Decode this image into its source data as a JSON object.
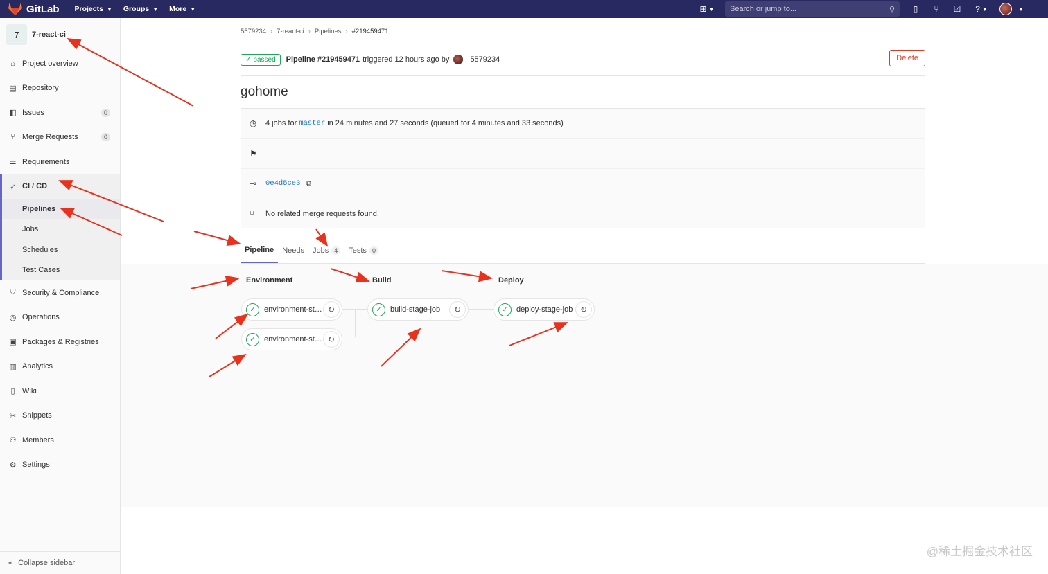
{
  "topbar": {
    "brand": "GitLab",
    "nav": [
      "Projects",
      "Groups",
      "More"
    ],
    "search_placeholder": "Search or jump to..."
  },
  "sidebar": {
    "project_avatar": "7",
    "project_name": "7-react-ci",
    "items": [
      {
        "label": "Project overview",
        "icon": "home-icon"
      },
      {
        "label": "Repository",
        "icon": "book-icon"
      },
      {
        "label": "Issues",
        "icon": "issues-icon",
        "badge": "0"
      },
      {
        "label": "Merge Requests",
        "icon": "merge-request-icon",
        "badge": "0"
      },
      {
        "label": "Requirements",
        "icon": "requirements-icon"
      }
    ],
    "cicd": {
      "label": "CI / CD",
      "sub": [
        "Pipelines",
        "Jobs",
        "Schedules",
        "Test Cases"
      ]
    },
    "items2": [
      {
        "label": "Security & Compliance",
        "icon": "shield-icon"
      },
      {
        "label": "Operations",
        "icon": "operations-icon"
      },
      {
        "label": "Packages & Registries",
        "icon": "package-icon"
      },
      {
        "label": "Analytics",
        "icon": "chart-icon"
      },
      {
        "label": "Wiki",
        "icon": "wiki-icon"
      },
      {
        "label": "Snippets",
        "icon": "scissors-icon"
      },
      {
        "label": "Members",
        "icon": "users-icon"
      },
      {
        "label": "Settings",
        "icon": "gear-icon"
      }
    ],
    "collapse": "Collapse sidebar"
  },
  "breadcrumb": [
    "5579234",
    "7-react-ci",
    "Pipelines",
    "#219459471"
  ],
  "header": {
    "status": "passed",
    "pipeline_id": "Pipeline #219459471",
    "triggered": "triggered 12 hours ago by",
    "user": "5579234",
    "delete_label": "Delete"
  },
  "title": "gohome",
  "info": {
    "jobs_prefix": "4 jobs for",
    "branch": "master",
    "duration": "in 24 minutes and 27 seconds (queued for 4 minutes and 33 seconds)",
    "commit": "0e4d5ce3",
    "merge": "No related merge requests found."
  },
  "tabs": [
    {
      "label": "Pipeline",
      "count": ""
    },
    {
      "label": "Needs",
      "count": ""
    },
    {
      "label": "Jobs",
      "count": "4"
    },
    {
      "label": "Tests",
      "count": "0"
    }
  ],
  "stages": [
    {
      "name": "Environment",
      "jobs": [
        "environment-stage-job",
        "environment-stage-job"
      ]
    },
    {
      "name": "Build",
      "jobs": [
        "build-stage-job"
      ]
    },
    {
      "name": "Deploy",
      "jobs": [
        "deploy-stage-job"
      ]
    }
  ],
  "watermark": "@稀土掘金技术社区",
  "colors": {
    "topbar": "#292961",
    "success": "#1aaa55",
    "danger": "#db3b21",
    "annotation": "#e8321e"
  }
}
